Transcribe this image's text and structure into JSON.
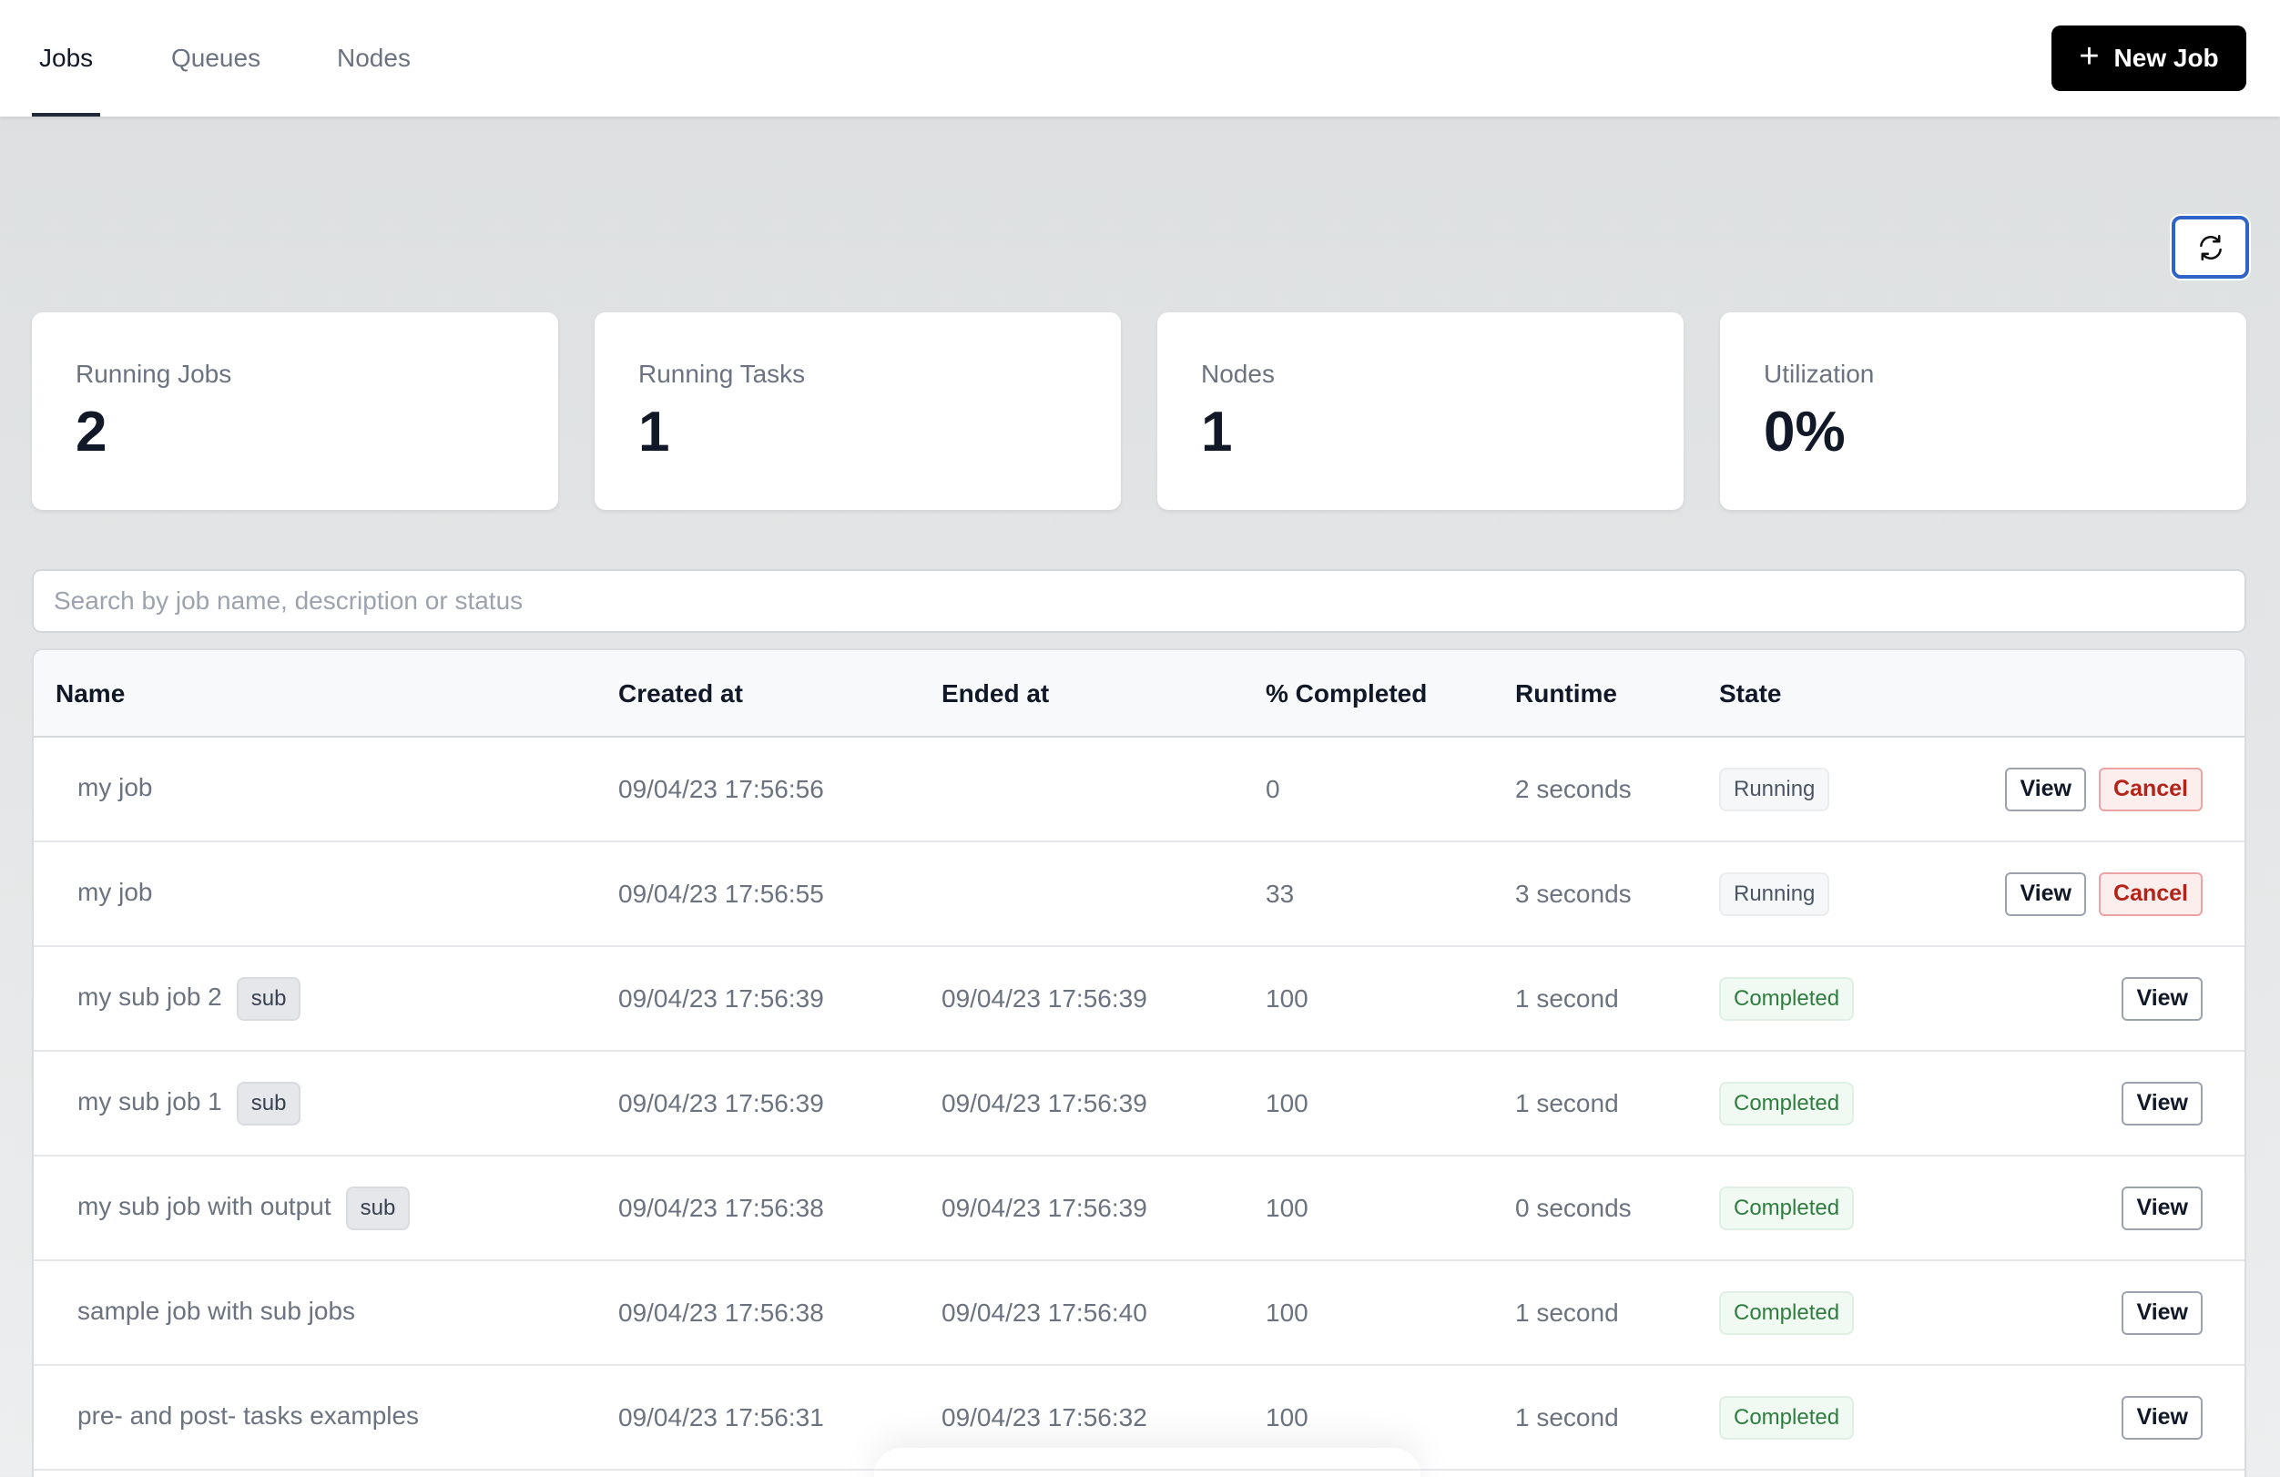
{
  "nav": {
    "tabs": [
      {
        "label": "Jobs",
        "active": true
      },
      {
        "label": "Queues",
        "active": false
      },
      {
        "label": "Nodes",
        "active": false
      }
    ],
    "new_job_label": "New Job",
    "new_job_icon": "plus-icon"
  },
  "refresh": {
    "icon": "refresh-icon",
    "focus_color": "#2f63c7"
  },
  "stats": [
    {
      "label": "Running Jobs",
      "value": "2"
    },
    {
      "label": "Running Tasks",
      "value": "1"
    },
    {
      "label": "Nodes",
      "value": "1"
    },
    {
      "label": "Utilization",
      "value": "0%"
    }
  ],
  "search": {
    "placeholder": "Search by job name, description or status",
    "value": ""
  },
  "table": {
    "columns": [
      "Name",
      "Created at",
      "Ended at",
      "% Completed",
      "Runtime",
      "State",
      ""
    ],
    "rows": [
      {
        "name": "my job",
        "sub": false,
        "created": "09/04/23 17:56:56",
        "ended": "",
        "pct": "0",
        "runtime": "2 seconds",
        "state": "Running",
        "actions": [
          "View",
          "Cancel"
        ]
      },
      {
        "name": "my job",
        "sub": false,
        "created": "09/04/23 17:56:55",
        "ended": "",
        "pct": "33",
        "runtime": "3 seconds",
        "state": "Running",
        "actions": [
          "View",
          "Cancel"
        ]
      },
      {
        "name": "my sub job 2",
        "sub": true,
        "created": "09/04/23 17:56:39",
        "ended": "09/04/23 17:56:39",
        "pct": "100",
        "runtime": "1 second",
        "state": "Completed",
        "actions": [
          "View"
        ]
      },
      {
        "name": "my sub job 1",
        "sub": true,
        "created": "09/04/23 17:56:39",
        "ended": "09/04/23 17:56:39",
        "pct": "100",
        "runtime": "1 second",
        "state": "Completed",
        "actions": [
          "View"
        ]
      },
      {
        "name": "my sub job with output",
        "sub": true,
        "created": "09/04/23 17:56:38",
        "ended": "09/04/23 17:56:39",
        "pct": "100",
        "runtime": "0 seconds",
        "state": "Completed",
        "actions": [
          "View"
        ]
      },
      {
        "name": "sample job with sub jobs",
        "sub": false,
        "created": "09/04/23 17:56:38",
        "ended": "09/04/23 17:56:40",
        "pct": "100",
        "runtime": "1 second",
        "state": "Completed",
        "actions": [
          "View"
        ]
      },
      {
        "name": "pre- and post- tasks examples",
        "sub": false,
        "created": "09/04/23 17:56:31",
        "ended": "09/04/23 17:56:32",
        "pct": "100",
        "runtime": "1 second",
        "state": "Completed",
        "actions": [
          "View"
        ]
      }
    ],
    "sub_badge_label": "sub"
  },
  "colors": {
    "running_text": "#4b5563",
    "completed_text": "#2f7d3e",
    "cancel_text": "#b42318",
    "primary_button": "#000000"
  }
}
